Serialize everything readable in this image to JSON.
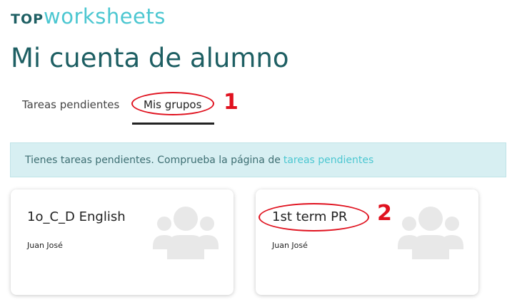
{
  "logo": {
    "top": "TOP",
    "worksheets": "worksheets"
  },
  "page_title": "Mi cuenta de alumno",
  "tabs": [
    {
      "label": "Tareas pendientes",
      "active": false
    },
    {
      "label": "Mis grupos",
      "active": true
    }
  ],
  "alert": {
    "text": "Tienes tareas pendientes. Comprueba la página de",
    "link": "tareas pendientes"
  },
  "groups": [
    {
      "name": "1o_C_D English",
      "owner": "Juan José",
      "icon": "group-icon"
    },
    {
      "name": "1st term PR",
      "owner": "Juan José",
      "icon": "group-icon"
    }
  ],
  "annotations": [
    "1",
    "2"
  ],
  "colors": {
    "brand_dark": "#1e5f63",
    "brand_light": "#4cc7d1",
    "annotation": "#e0121f",
    "alert_bg": "#d7eff2"
  }
}
